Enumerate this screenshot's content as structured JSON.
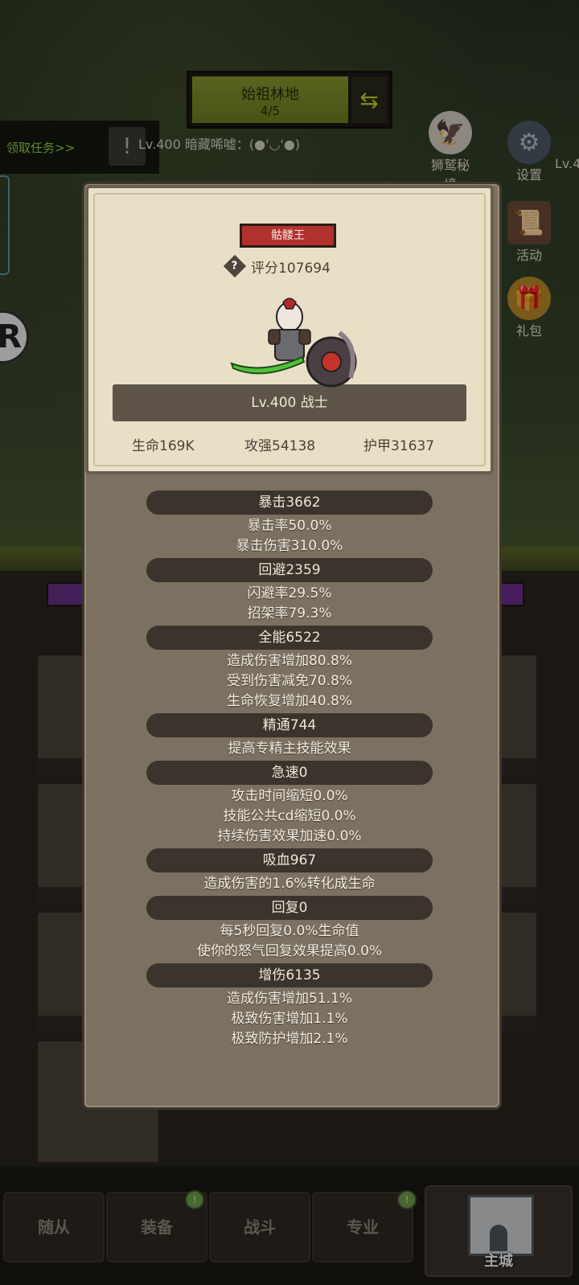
{
  "hud": {
    "stage_name": "始祖林地",
    "stage_progress": "4/5",
    "task_label": "领取任务>>",
    "chat": "Lv.400 暗藏唏嘘：(●'◡'●)",
    "lv_edge": "Lv.4",
    "side_icons": [
      {
        "label": "狮鹫秘境",
        "icon": "griffin-icon"
      },
      {
        "label": "设置",
        "icon": "gear-icon"
      },
      {
        "label": "活动",
        "icon": "scroll-icon"
      },
      {
        "label": "礼包",
        "icon": "gift-icon"
      }
    ]
  },
  "hero": {
    "name": "骷髅王",
    "score_label": "评分107694",
    "level_class": "Lv.400 战士",
    "hp": "生命169K",
    "attack": "攻强54138",
    "armor": "护甲31637"
  },
  "stats": [
    {
      "header": "暴击3662",
      "lines": [
        "暴击率50.0%",
        "暴击伤害310.0%"
      ]
    },
    {
      "header": "回避2359",
      "lines": [
        "闪避率29.5%",
        "招架率79.3%"
      ]
    },
    {
      "header": "全能6522",
      "lines": [
        "造成伤害增加80.8%",
        "受到伤害减免70.8%",
        "生命恢复增加40.8%"
      ]
    },
    {
      "header": "精通744",
      "lines": [
        "提高专精主技能效果"
      ]
    },
    {
      "header": "急速0",
      "lines": [
        "攻击时间缩短0.0%",
        "技能公共cd缩短0.0%",
        "持续伤害效果加速0.0%"
      ]
    },
    {
      "header": "吸血967",
      "lines": [
        "造成伤害的1.6%转化成生命"
      ]
    },
    {
      "header": "回复0",
      "lines": [
        "每5秒回复0.0%生命值",
        "使你的怒气回复效果提高0.0%"
      ]
    },
    {
      "header": "增伤6135",
      "lines": [
        "造成伤害增加51.1%",
        "极致伤害增加1.1%",
        "极致防护增加2.1%"
      ]
    }
  ],
  "nav": {
    "items": [
      "随从",
      "装备",
      "战斗",
      "专业"
    ],
    "main_city": "主城",
    "badge": "!"
  },
  "colors": {
    "name_badge": "#b0312e",
    "stage_bar": "#8a9a2e",
    "task_green": "#8cd24a",
    "card_bg": "#e9dfc7",
    "panel_bg": "#7c7060"
  }
}
